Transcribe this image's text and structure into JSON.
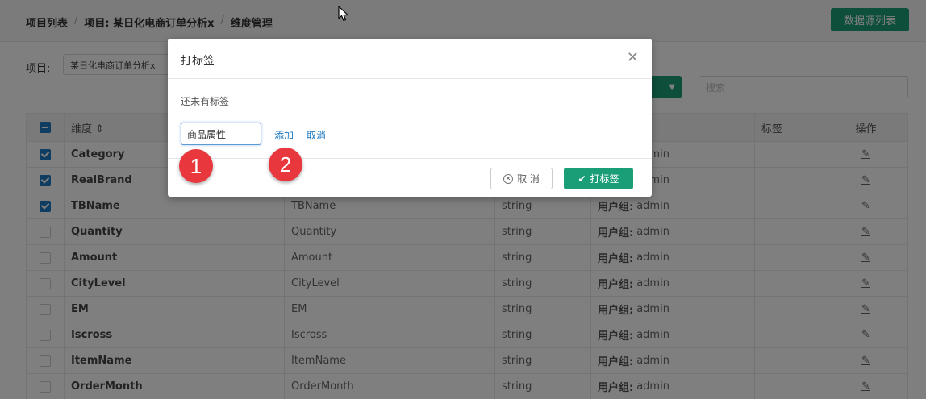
{
  "breadcrumb": [
    "项目列表",
    "项目: 某日化电商订单分析x",
    "维度管理"
  ],
  "datasource_button": "数据源列表",
  "project": {
    "label": "项目:",
    "value": "某日化电商订单分析x"
  },
  "search": {
    "placeholder": "搜索"
  },
  "table": {
    "headers": {
      "dimension": "维度 ⇕",
      "owner": "",
      "tag": "标签",
      "operation": "操作"
    },
    "owner_prefix": "用户组:",
    "rows": [
      {
        "checked": true,
        "dimension": "Category",
        "name": "",
        "type": "",
        "owner": "admin"
      },
      {
        "checked": true,
        "dimension": "RealBrand",
        "name": "",
        "type": "",
        "owner": "admin"
      },
      {
        "checked": true,
        "dimension": "TBName",
        "name": "TBName",
        "type": "string",
        "owner": "admin"
      },
      {
        "checked": false,
        "dimension": "Quantity",
        "name": "Quantity",
        "type": "string",
        "owner": "admin"
      },
      {
        "checked": false,
        "dimension": "Amount",
        "name": "Amount",
        "type": "string",
        "owner": "admin"
      },
      {
        "checked": false,
        "dimension": "CityLevel",
        "name": "CityLevel",
        "type": "string",
        "owner": "admin"
      },
      {
        "checked": false,
        "dimension": "EM",
        "name": "EM",
        "type": "string",
        "owner": "admin"
      },
      {
        "checked": false,
        "dimension": "Iscross",
        "name": "Iscross",
        "type": "string",
        "owner": "admin"
      },
      {
        "checked": false,
        "dimension": "ItemName",
        "name": "ItemName",
        "type": "string",
        "owner": "admin"
      },
      {
        "checked": false,
        "dimension": "OrderMonth",
        "name": "OrderMonth",
        "type": "string",
        "owner": "admin"
      }
    ]
  },
  "dialog": {
    "title": "打标签",
    "no_tags": "还未有标签",
    "tag_input_value": "商品属性",
    "add_link": "添加",
    "cancel_link": "取消",
    "cancel_button": "取 消",
    "submit_button": "打标签"
  },
  "annotations": [
    "1",
    "2"
  ],
  "colors": {
    "accent": "#1a9e77",
    "link": "#1f7ac2",
    "badge": "#e8383e"
  },
  "icons": [
    "close-icon",
    "cancel-circle-icon",
    "check-icon",
    "edit-icon",
    "sort-icon",
    "mouse-cursor-icon"
  ]
}
